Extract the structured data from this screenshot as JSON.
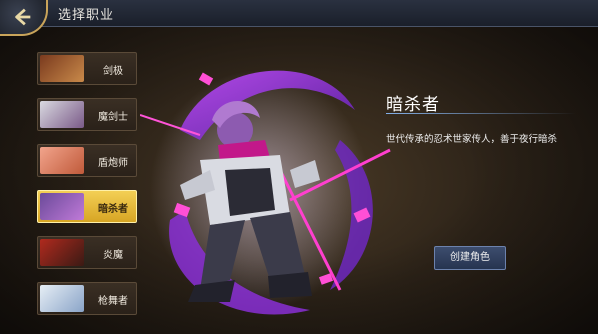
{
  "header": {
    "title": "选择职业",
    "back_icon": "back-arrow-icon"
  },
  "classes": [
    {
      "label": "剑极",
      "selected": false,
      "portrait_colors": [
        "#7a3a1e",
        "#c98a4a"
      ]
    },
    {
      "label": "魔剑士",
      "selected": false,
      "portrait_colors": [
        "#d9d9e0",
        "#7a5a88"
      ]
    },
    {
      "label": "盾炮师",
      "selected": false,
      "portrait_colors": [
        "#f2a48c",
        "#c05a3a"
      ]
    },
    {
      "label": "暗杀者",
      "selected": true,
      "portrait_colors": [
        "#6b4a9a",
        "#c07ad8"
      ]
    },
    {
      "label": "炎魔",
      "selected": false,
      "portrait_colors": [
        "#b02a1e",
        "#3a1a14"
      ]
    },
    {
      "label": "枪舞者",
      "selected": false,
      "portrait_colors": [
        "#e6eef5",
        "#8aa4c8"
      ]
    }
  ],
  "selected_class": {
    "name": "暗杀者",
    "description": "世代传承的忍术世家传人，善于夜行暗杀"
  },
  "actions": {
    "create_label": "创建角色"
  },
  "colors": {
    "accent_gold": "#e8b93a",
    "effect_purple": "#9b3ee0",
    "effect_magenta": "#e43cd0"
  }
}
